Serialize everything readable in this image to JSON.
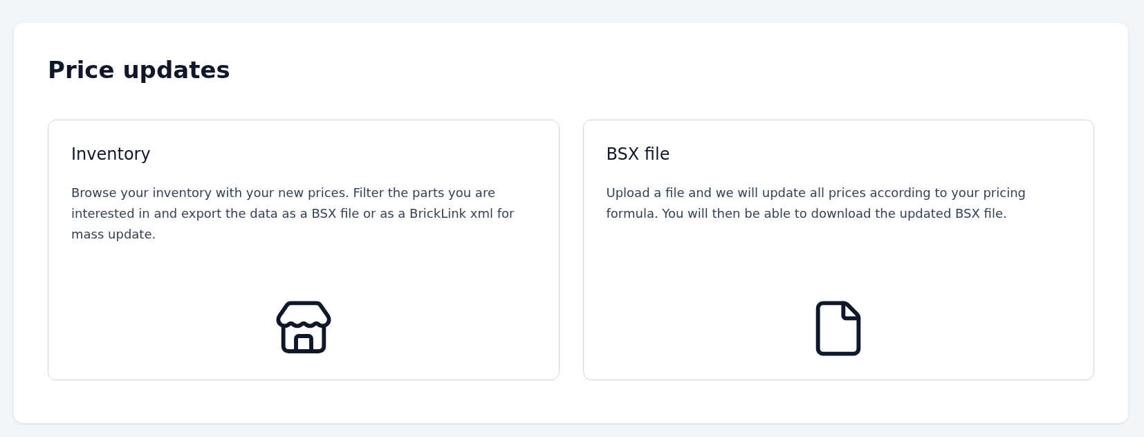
{
  "title": "Price updates",
  "options": [
    {
      "kind": "store",
      "title": "Inventory",
      "description": "Browse your inventory with your new prices. Filter the parts you are interested in and export the data as a BSX file or as a BrickLink xml for mass update."
    },
    {
      "kind": "file",
      "title": "BSX file",
      "description": "Upload a file and we will update all prices according to your pricing formula. You will then be able to download the updated BSX file."
    }
  ]
}
